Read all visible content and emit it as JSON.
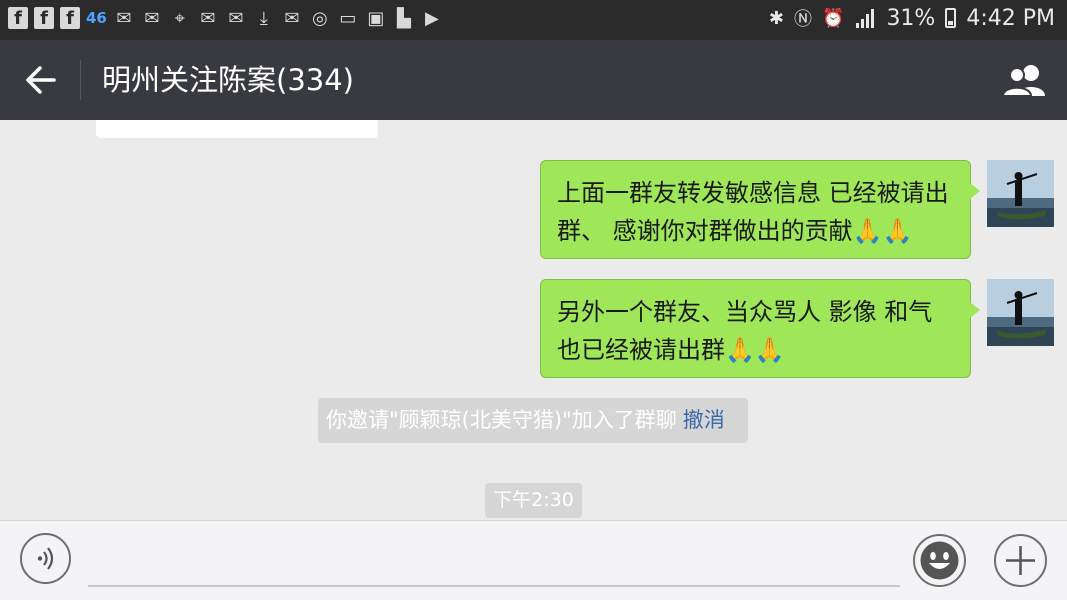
{
  "status_bar": {
    "network_label": "46",
    "battery_percent": "31%",
    "time": "4:42 PM"
  },
  "header": {
    "title": "明州关注陈案(334)"
  },
  "messages": [
    {
      "sender": "self",
      "text": "上面一群友转发敏感信息 已经被请出群、 感谢你对群做出的贡献",
      "emoji": "🙏🙏"
    },
    {
      "sender": "self",
      "text": "另外一个群友、当众骂人 影像 和气也已经被请出群",
      "emoji": "🙏🙏"
    }
  ],
  "system_notice": {
    "text": "你邀请\"顾颖琼(北美守猎)\"加入了群聊",
    "action": "撤消"
  },
  "timestamp": "下午2:30",
  "colors": {
    "titlebar": "#393a3f",
    "bubble_self": "#9fe658",
    "chat_bg": "#ebebeb",
    "link": "#3d6aa8"
  }
}
